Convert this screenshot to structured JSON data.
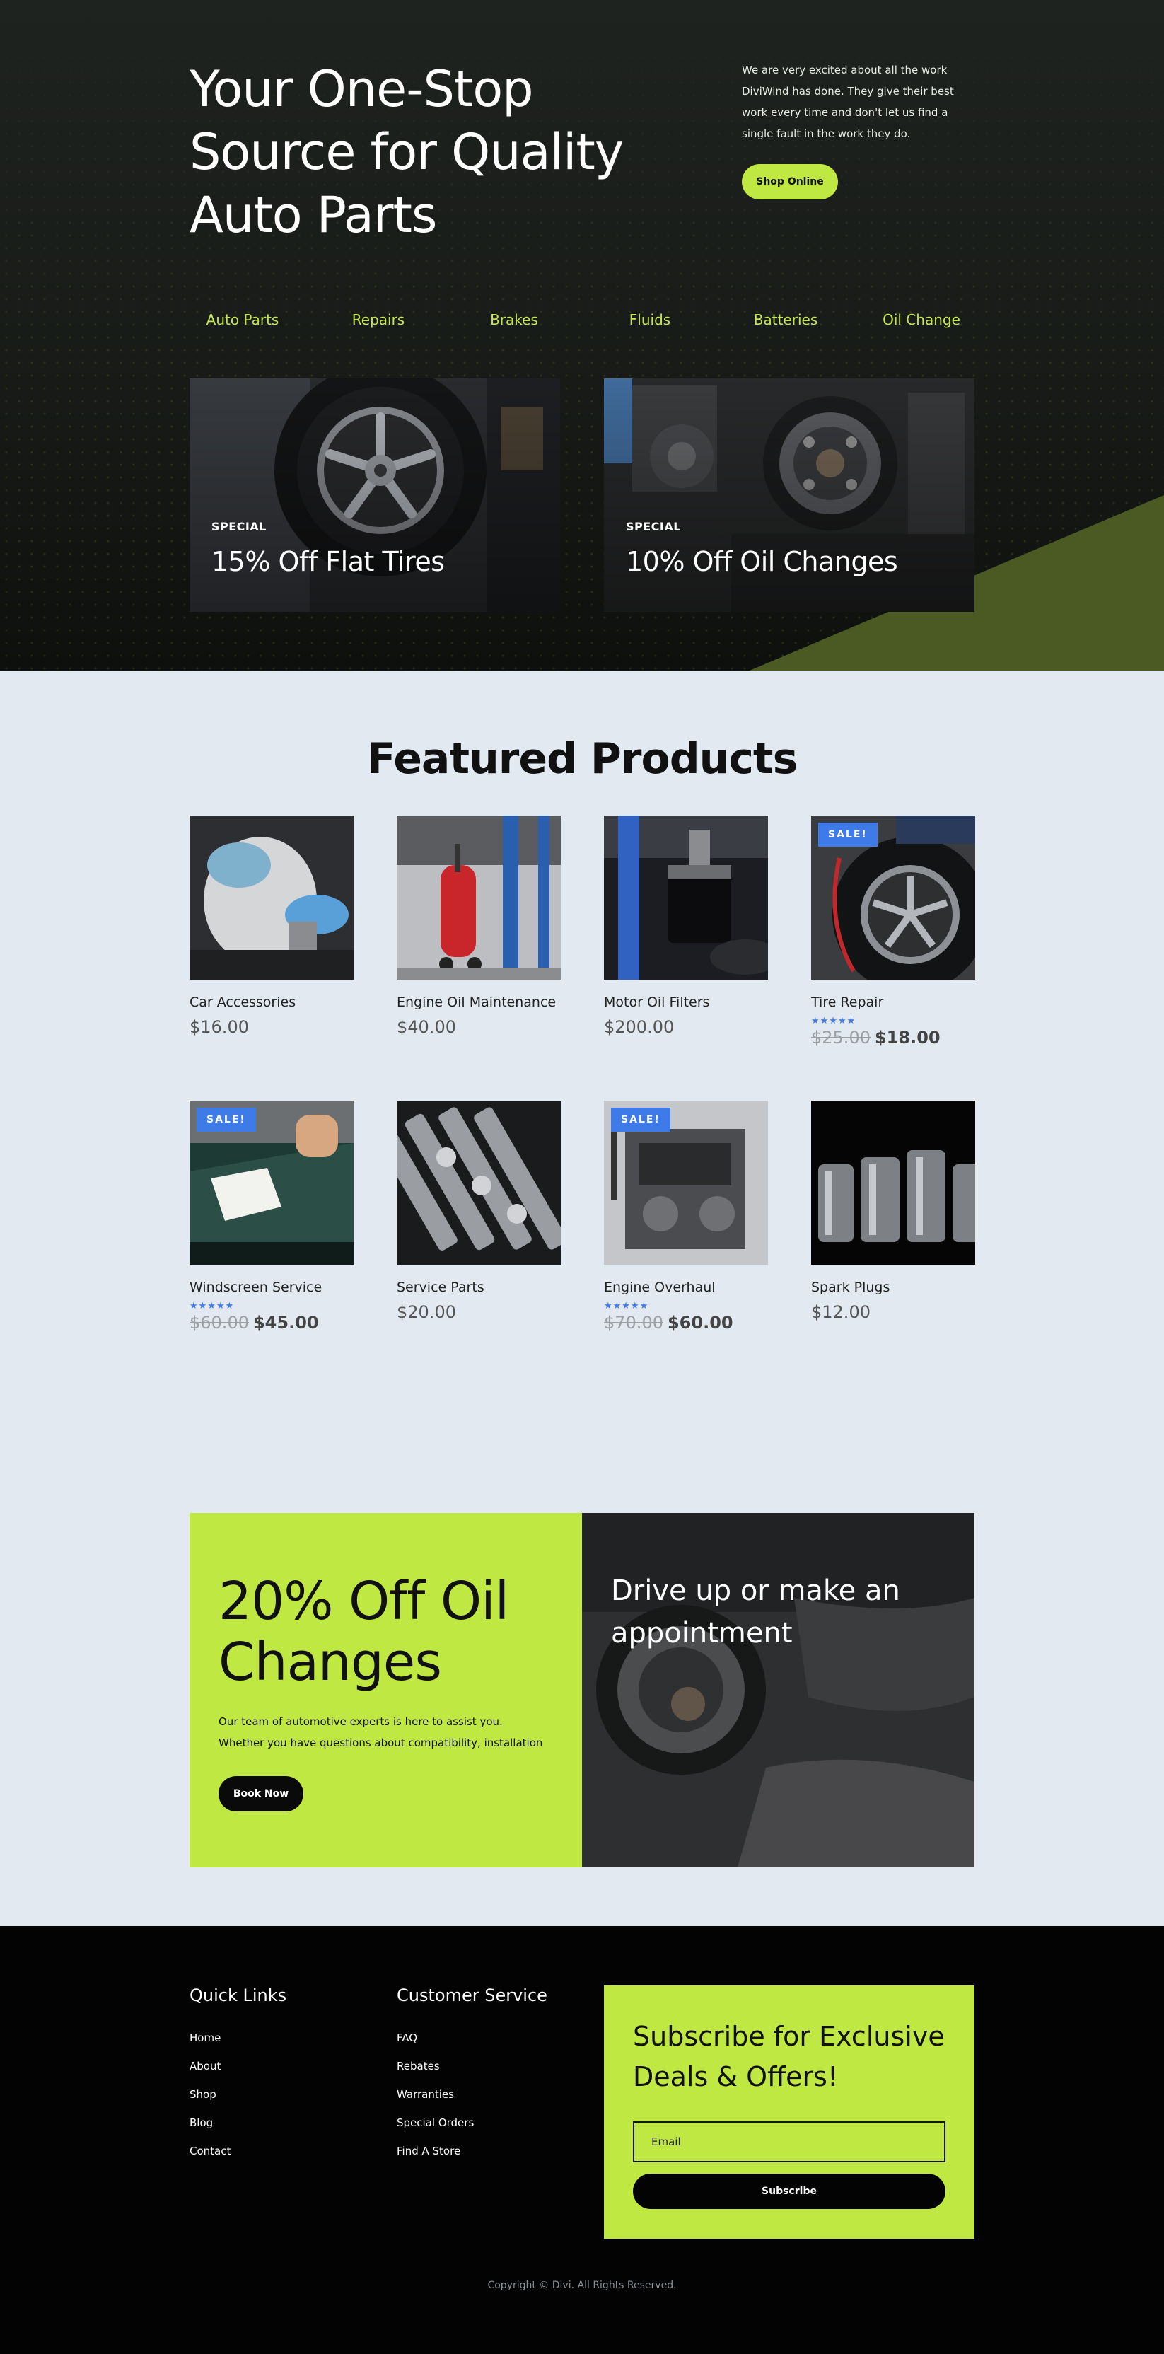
{
  "hero": {
    "title": "Your One-Stop Source for Quality Auto Parts",
    "description": "We are very excited about all the work DiviWind has done. They give their best work every time and don't let us find a single fault in the work they do.",
    "cta_label": "Shop Online",
    "categories": [
      "Auto Parts",
      "Repairs",
      "Brakes",
      "Fluids",
      "Batteries",
      "Oil Change"
    ],
    "promos": [
      {
        "tag": "SPECIAL",
        "title": "15% Off Flat Tires",
        "image": "tire-photo"
      },
      {
        "tag": "SPECIAL",
        "title": "10% Off Oil Changes",
        "image": "engine-pulley-photo"
      }
    ]
  },
  "products": {
    "title": "Featured Products",
    "items": [
      {
        "name": "Car Accessories",
        "price": "$16.00",
        "sale": false,
        "image": "coolant-reservoir-photo"
      },
      {
        "name": "Engine Oil Maintenance",
        "price": "$40.00",
        "sale": false,
        "image": "oil-drain-tank-photo"
      },
      {
        "name": "Motor Oil Filters",
        "price": "$200.00",
        "sale": false,
        "image": "oil-filter-photo"
      },
      {
        "name": "Tire Repair",
        "old_price": "$25.00",
        "price": "$18.00",
        "sale": true,
        "rating": "★★★★★",
        "image": "tire-inflation-photo"
      },
      {
        "name": "Windscreen Service",
        "old_price": "$60.00",
        "price": "$45.00",
        "sale": true,
        "rating": "★★★★★",
        "image": "windscreen-photo"
      },
      {
        "name": "Service Parts",
        "price": "$20.00",
        "sale": false,
        "image": "socket-set-photo"
      },
      {
        "name": "Engine Overhaul",
        "old_price": "$70.00",
        "price": "$60.00",
        "sale": true,
        "rating": "★★★★★",
        "image": "engine-block-photo"
      },
      {
        "name": "Spark Plugs",
        "price": "$12.00",
        "sale": false,
        "image": "spark-sockets-photo"
      }
    ],
    "sale_label": "SALE!"
  },
  "cta": {
    "title": "20% Off Oil Changes",
    "text": "Our team of automotive experts is here to assist you. Whether you have questions about compatibility, installation",
    "button": "Book Now",
    "right_title": "Drive up or make an appointment"
  },
  "footer": {
    "quick_links_title": "Quick Links",
    "quick_links": [
      "Home",
      "About",
      "Shop",
      "Blog",
      "Contact"
    ],
    "service_title": "Customer Service",
    "service_links": [
      "FAQ",
      "Rebates",
      "Warranties",
      "Special Orders",
      "Find A Store"
    ],
    "subscribe_title": "Subscribe for Exclusive Deals & Offers!",
    "email_placeholder": "Email",
    "subscribe_button": "Subscribe",
    "copyright": "Copyright © Divi. All Rights Reserved."
  },
  "colors": {
    "accent": "#c0e843",
    "sale_badge": "#3f7be8",
    "dark": "#030303"
  }
}
